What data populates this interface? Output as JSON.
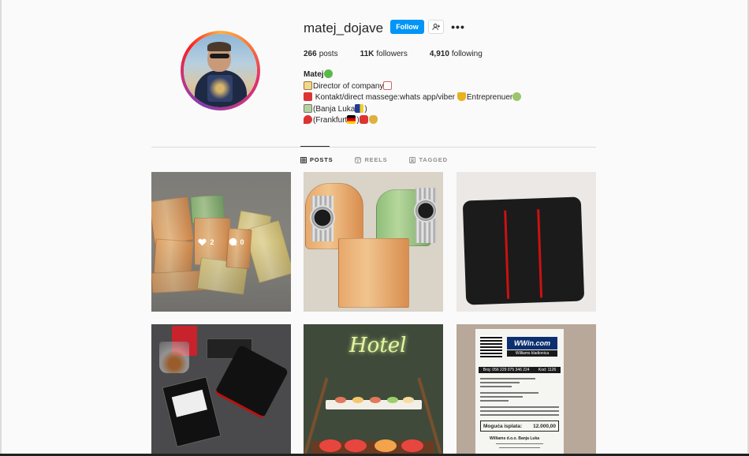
{
  "profile": {
    "username": "matej_dojave",
    "follow_label": "Follow",
    "more_label": "•••",
    "stats": {
      "posts_count": "266",
      "posts_label": "posts",
      "followers_count": "11K",
      "followers_label": "followers",
      "following_count": "4,910",
      "following_label": "following"
    },
    "bio": {
      "name": "Matej",
      "line1": "Director of company",
      "line2a": " Kontakt/direct massege:whats app/viber ",
      "line2b": "Entreprenuer",
      "line3": "(Banja Luka",
      "line3_end": ")",
      "line4": "(Frankfurt",
      "line4_end": ")"
    }
  },
  "tabs": [
    {
      "label": "POSTS",
      "icon": "grid-icon",
      "active": true
    },
    {
      "label": "REELS",
      "icon": "reels-icon",
      "active": false
    },
    {
      "label": "TAGGED",
      "icon": "tagged-icon",
      "active": false
    }
  ],
  "posts": [
    {
      "likes": "2",
      "comments": "0",
      "hovered": true
    },
    {
      "notes": "money stack",
      "hovered": false
    }
  ],
  "receipt": {
    "logo": "WWin.com",
    "sub": "Williams kladionica",
    "bar_left": "Broj: 056 229 075 346 224",
    "bar_right": "Kod: 1126",
    "payout_label": "Moguća isplata:",
    "payout_value": "12.000,00",
    "footer1": "Williams d.o.o. Banja Luka"
  },
  "neon_text": "Hotel",
  "colors": {
    "accent": "#0095f6",
    "text": "#262626",
    "muted": "#8e8e8e",
    "border": "#dbdbdb",
    "background": "#fafafa"
  }
}
